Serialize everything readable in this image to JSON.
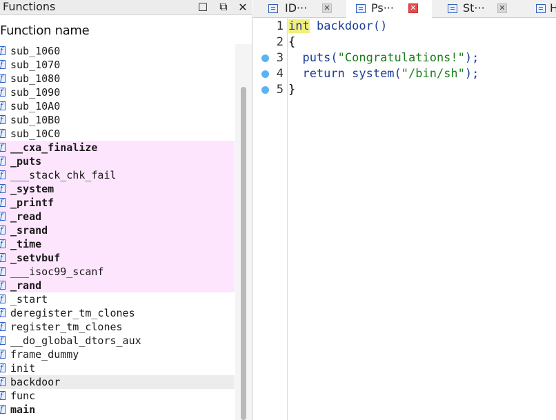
{
  "functions_panel": {
    "title": "Functions",
    "column_header": "Function name",
    "buttons": {
      "maximize": "☐",
      "float": "⧉",
      "close": "✕"
    },
    "items": [
      {
        "name": "sub_1060",
        "style": "normal"
      },
      {
        "name": "sub_1070",
        "style": "normal"
      },
      {
        "name": "sub_1080",
        "style": "normal"
      },
      {
        "name": "sub_1090",
        "style": "normal"
      },
      {
        "name": "sub_10A0",
        "style": "normal"
      },
      {
        "name": "sub_10B0",
        "style": "normal"
      },
      {
        "name": "sub_10C0",
        "style": "normal"
      },
      {
        "name": "__cxa_finalize",
        "style": "lib-bold"
      },
      {
        "name": "_puts",
        "style": "lib-bold"
      },
      {
        "name": "___stack_chk_fail",
        "style": "lib"
      },
      {
        "name": "_system",
        "style": "lib-bold"
      },
      {
        "name": "_printf",
        "style": "lib-bold"
      },
      {
        "name": "_read",
        "style": "lib-bold"
      },
      {
        "name": "_srand",
        "style": "lib-bold"
      },
      {
        "name": "_time",
        "style": "lib-bold"
      },
      {
        "name": "_setvbuf",
        "style": "lib-bold"
      },
      {
        "name": "___isoc99_scanf",
        "style": "lib"
      },
      {
        "name": "_rand",
        "style": "lib-bold"
      },
      {
        "name": "_start",
        "style": "normal"
      },
      {
        "name": "deregister_tm_clones",
        "style": "normal"
      },
      {
        "name": "register_tm_clones",
        "style": "normal"
      },
      {
        "name": "__do_global_dtors_aux",
        "style": "normal"
      },
      {
        "name": "frame_dummy",
        "style": "normal"
      },
      {
        "name": "init",
        "style": "normal"
      },
      {
        "name": "backdoor",
        "style": "selected"
      },
      {
        "name": "func",
        "style": "normal"
      },
      {
        "name": "main",
        "style": "bold"
      }
    ]
  },
  "tabs": [
    {
      "label": "ID···",
      "active": false
    },
    {
      "label": "Ps···",
      "active": true
    },
    {
      "label": "St···",
      "active": false
    },
    {
      "label": "H",
      "active": false
    }
  ],
  "code": {
    "lines": [
      {
        "num": "1",
        "bp": false,
        "tokens": [
          {
            "t": "int",
            "c": "kw-hl"
          },
          {
            "t": " backdoor()",
            "c": "tok-fn"
          }
        ]
      },
      {
        "num": "2",
        "bp": false,
        "tokens": [
          {
            "t": "{",
            "c": "tok-punc"
          }
        ]
      },
      {
        "num": "3",
        "bp": true,
        "tokens": [
          {
            "t": "  puts(",
            "c": "tok-fn"
          },
          {
            "t": "\"Congratulations!\"",
            "c": "tok-str"
          },
          {
            "t": ");",
            "c": "tok-fn"
          }
        ]
      },
      {
        "num": "4",
        "bp": true,
        "tokens": [
          {
            "t": "  return ",
            "c": "tok-kw"
          },
          {
            "t": "system(",
            "c": "tok-fn"
          },
          {
            "t": "\"/bin/sh\"",
            "c": "tok-str"
          },
          {
            "t": ");",
            "c": "tok-fn"
          }
        ]
      },
      {
        "num": "5",
        "bp": true,
        "tokens": [
          {
            "t": "}",
            "c": "tok-punc"
          }
        ]
      }
    ]
  },
  "colors": {
    "library_function_bg": "#fde6fd",
    "selected_row_bg": "#ececec",
    "keyword_highlight": "#f2f07a",
    "string": "#1c7f1c",
    "identifier": "#1b3d9a",
    "breakpoint": "#59b4f3",
    "active_tab_close": "#e84b4b"
  }
}
